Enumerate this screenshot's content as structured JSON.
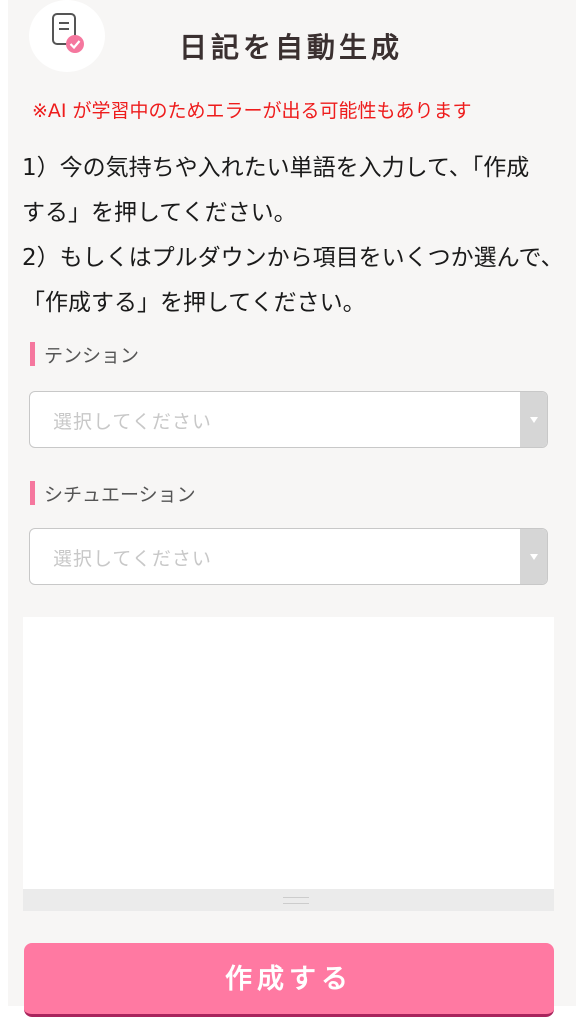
{
  "header": {
    "title": "日記を自動生成",
    "icon": "document-check-icon"
  },
  "warning": "※AI が学習中のためエラーが出る可能性もあります",
  "instructions": {
    "line1": "1）今の気持ちや入れたい単語を入力して、「作成",
    "line2": "する」を押してください。",
    "line3": "2）もしくはプルダウンから項目をいくつか選んで、",
    "line4": "「作成する」を押してください。"
  },
  "fields": {
    "tension": {
      "label": "テンション",
      "placeholder": "選択してください"
    },
    "situation": {
      "label": "シチュエーション",
      "placeholder": "選択してください"
    }
  },
  "textarea": {
    "value": ""
  },
  "submit_label": "作成する",
  "colors": {
    "accent": "#ff79a2",
    "warning": "#ee1c1c",
    "label_bar": "#f5779e"
  }
}
